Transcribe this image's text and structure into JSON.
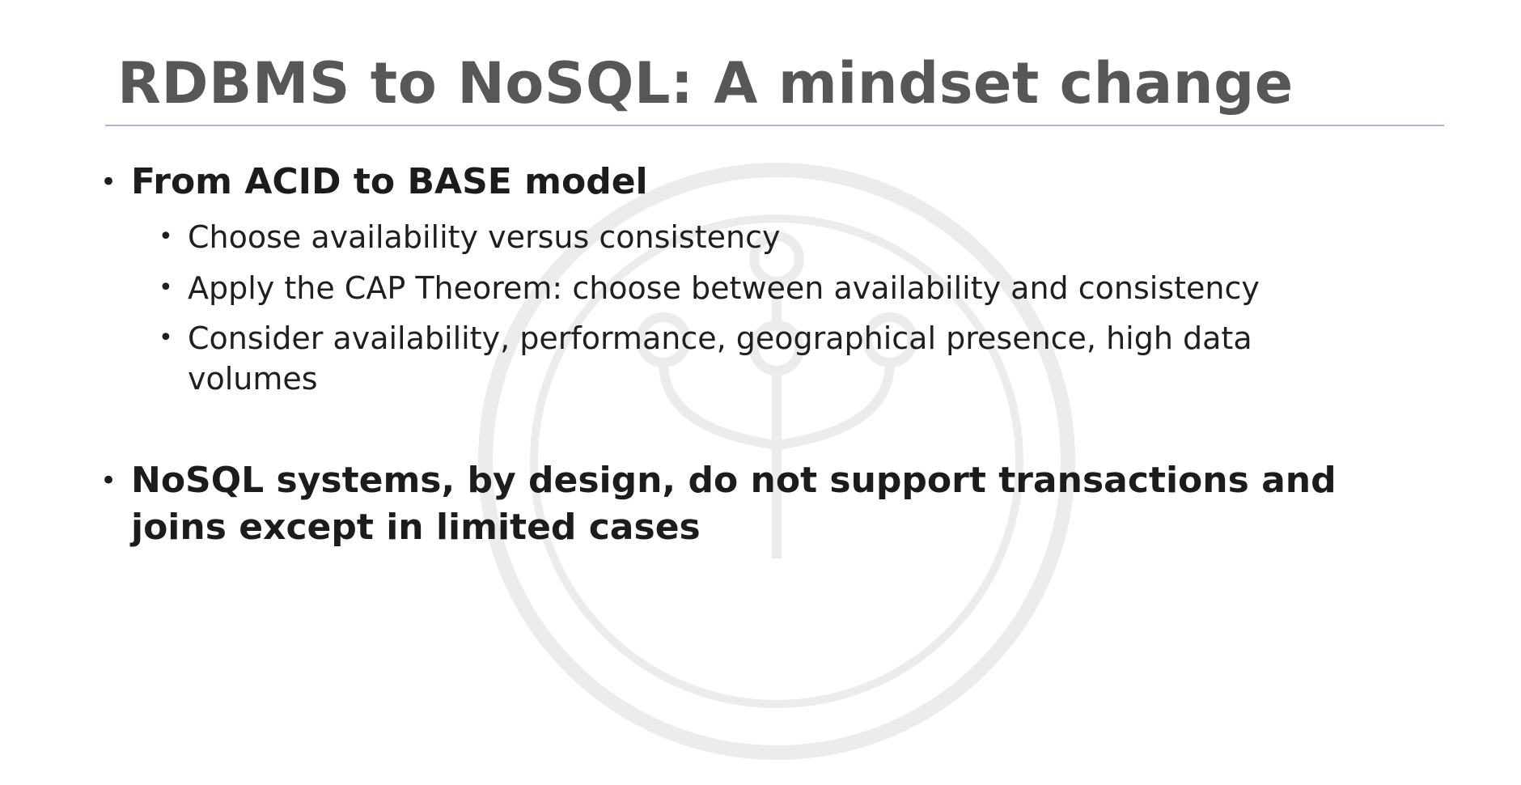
{
  "slide": {
    "title": "RDBMS to NoSQL: A mindset change",
    "bullets": [
      {
        "text": "From ACID to BASE model",
        "subitems": [
          "Choose availability versus consistency",
          "Apply the CAP Theorem: choose between availability and consistency",
          "Consider availability, performance, geographical presence, high data volumes"
        ]
      },
      {
        "text": "NoSQL systems, by design, do not support transactions and joins except in limited cases"
      }
    ],
    "bullet_glyph": "•",
    "watermark_icon": "network-tree-icon",
    "colors": {
      "title": "#575757",
      "rule": "#b4b0d6",
      "body": "#1c1c1c"
    }
  }
}
